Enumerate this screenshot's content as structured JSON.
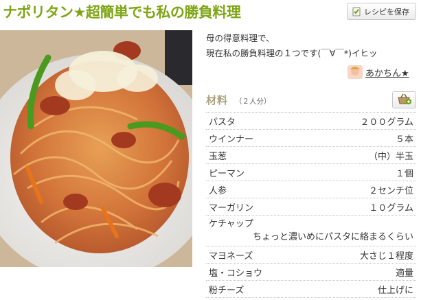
{
  "recipe": {
    "title": "ナポリタン★超簡単でも私の勝負料理",
    "save_button": "レシピを保存",
    "description_lines": [
      "母の得意料理で、",
      "現在私の勝負料理の１つです(￣∀￣*)イヒッ"
    ],
    "author": "あかちん★"
  },
  "ingredients": {
    "heading": "材料",
    "servings": "（２人分）",
    "items": [
      {
        "name": "パスタ",
        "qty": "２００グラム"
      },
      {
        "name": "ウインナー",
        "qty": "５本"
      },
      {
        "name": "玉葱",
        "qty": "（中）半玉"
      },
      {
        "name": "ピーマン",
        "qty": "１個"
      },
      {
        "name": "人参",
        "qty": "２センチ位"
      },
      {
        "name": "マーガリン",
        "qty": "１０グラム"
      },
      {
        "name": "ケチャップ",
        "qty": "ちょっと濃いめにパスタに絡まるくらい"
      },
      {
        "name": "マヨネーズ",
        "qty": "大さじ１程度"
      },
      {
        "name": "塩・コショウ",
        "qty": "適量"
      },
      {
        "name": "粉チーズ",
        "qty": "仕上げに"
      }
    ]
  },
  "icons": {
    "save": "save-recipe-icon",
    "cart": "shopping-basket-icon"
  },
  "colors": {
    "title": "#7ea514",
    "heading": "#a9a07e"
  }
}
